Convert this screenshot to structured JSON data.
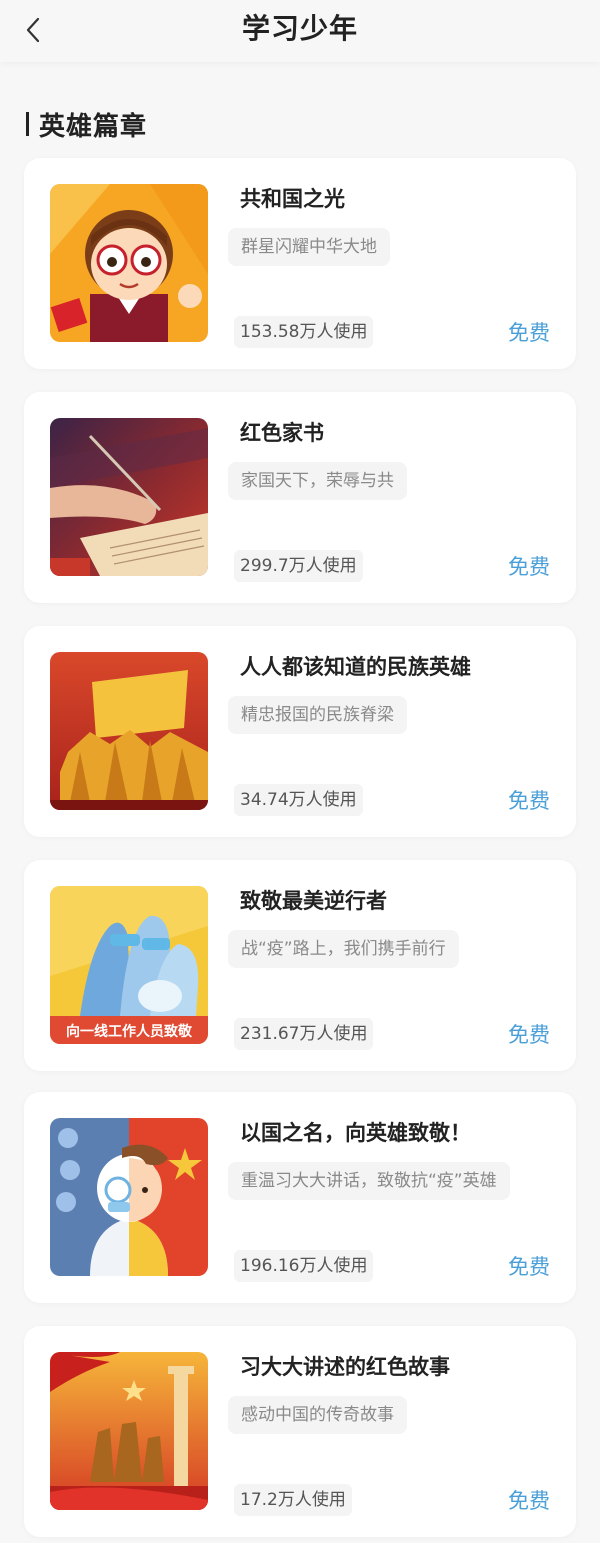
{
  "nav": {
    "title": "学习少年",
    "back_icon": "chevron-left-icon"
  },
  "section": {
    "title": "英雄篇章"
  },
  "cards": [
    {
      "title": "共和国之光",
      "tag": "群星闪耀中华大地",
      "usage": "153.58万人使用",
      "price": "免费"
    },
    {
      "title": "红色家书",
      "tag": "家国天下，荣辱与共",
      "usage": "299.7万人使用",
      "price": "免费"
    },
    {
      "title": "人人都该知道的民族英雄",
      "tag": "精忠报国的民族脊梁",
      "usage": "34.74万人使用",
      "price": "免费"
    },
    {
      "title": "致敬最美逆行者",
      "tag": "战“疫”路上，我们携手前行",
      "usage": "231.67万人使用",
      "price": "免费",
      "thumb_caption": "向一线工作人员致敬"
    },
    {
      "title": "以国之名，向英雄致敬！",
      "tag": "重温习大大讲话，致敬抗“疫”英雄",
      "usage": "196.16万人使用",
      "price": "免费"
    },
    {
      "title": "习大大讲述的红色故事",
      "tag": "感动中国的传奇故事",
      "usage": "17.2万人使用",
      "price": "免费"
    }
  ],
  "colors": {
    "accent": "#4a9fd8",
    "background": "#f7f7f8",
    "card": "#ffffff",
    "tag_bg": "#f4f4f5"
  }
}
